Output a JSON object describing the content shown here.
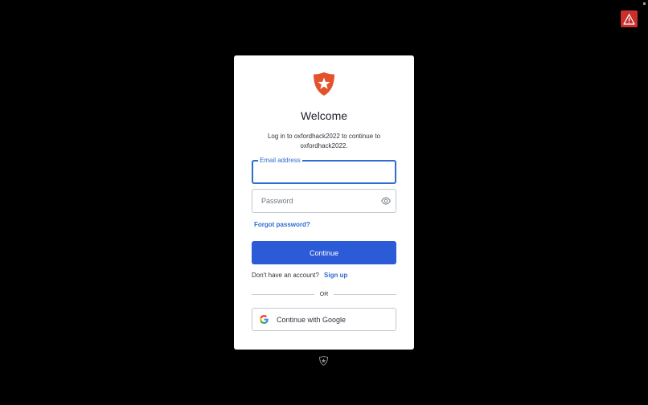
{
  "login": {
    "title": "Welcome",
    "subtitle": "Log in to oxfordhack2022 to continue to oxfordhack2022.",
    "email": {
      "label": "Email address",
      "value": ""
    },
    "password": {
      "placeholder": "Password"
    },
    "forgot_password": "Forgot password?",
    "continue_label": "Continue",
    "signup_prompt": "Don't have an account?",
    "signup_link": "Sign up",
    "divider": "OR",
    "google_label": "Continue with Google"
  },
  "icons": {
    "alert": "warning-triangle-icon",
    "brand": "auth0-shield-star-icon",
    "show_password": "eye-icon",
    "google": "google-g-icon",
    "footer": "auth0-badge-icon"
  },
  "colors": {
    "background": "#000000",
    "card": "#ffffff",
    "accent": "#2f6bd0",
    "primary_button": "#2b5bd6",
    "brand": "#e2532d",
    "alert": "#c9302c"
  }
}
